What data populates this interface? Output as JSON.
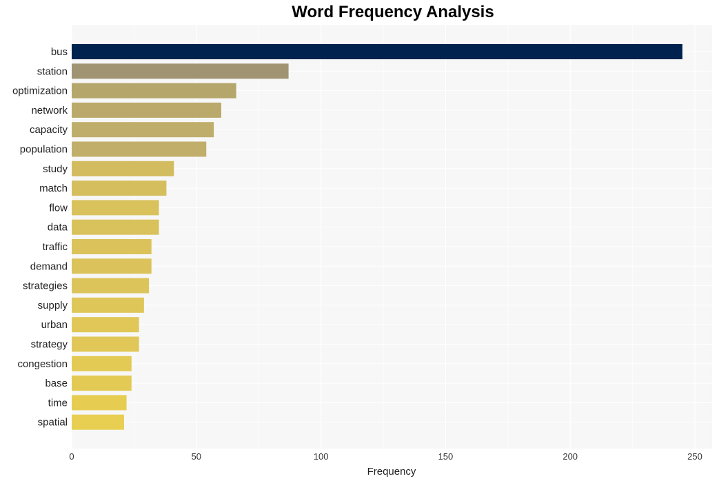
{
  "chart_data": {
    "type": "bar",
    "orientation": "horizontal",
    "title": "Word Frequency Analysis",
    "xlabel": "Frequency",
    "ylabel": "",
    "xlim": [
      0,
      257
    ],
    "xticks": [
      0,
      50,
      100,
      150,
      200,
      250
    ],
    "grid": true,
    "categories": [
      "bus",
      "station",
      "optimization",
      "network",
      "capacity",
      "population",
      "study",
      "match",
      "flow",
      "data",
      "traffic",
      "demand",
      "strategies",
      "supply",
      "urban",
      "strategy",
      "congestion",
      "base",
      "time",
      "spatial"
    ],
    "values": [
      245,
      87,
      66,
      60,
      57,
      54,
      41,
      38,
      35,
      35,
      32,
      32,
      31,
      29,
      27,
      27,
      24,
      24,
      22,
      21
    ],
    "colors": [
      "#00224e",
      "#a09473",
      "#b5a76c",
      "#bba96b",
      "#bfad6b",
      "#c0ae6a",
      "#d2bc5f",
      "#d5be5d",
      "#d9c25c",
      "#d9c25c",
      "#dbc25a",
      "#dbc25a",
      "#dcc45a",
      "#dfc658",
      "#e0c757",
      "#e0c757",
      "#e3ca54",
      "#e3ca54",
      "#e6cd52",
      "#e8cf51"
    ],
    "background": "#f7f7f7"
  }
}
